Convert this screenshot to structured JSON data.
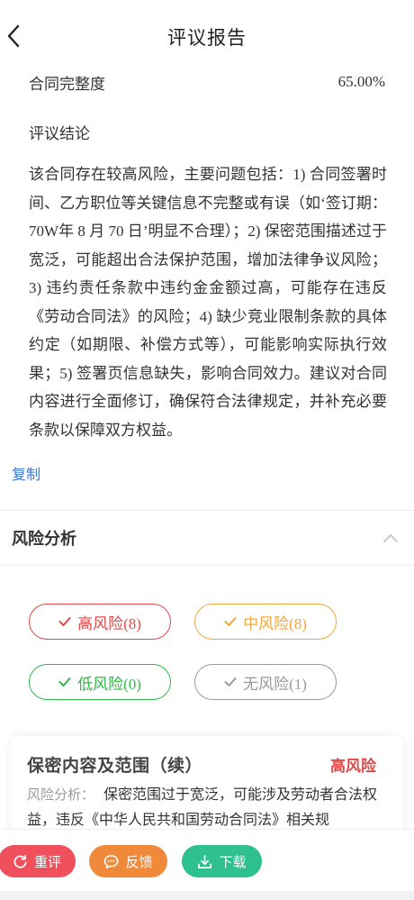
{
  "header": {
    "title": "评议报告",
    "back_icon": "chevron-left-icon"
  },
  "completeness": {
    "label": "合同完整度",
    "value": "65.00%"
  },
  "conclusion": {
    "label": "评议结论",
    "text": "该合同存在较高风险，主要问题包括：1) 合同签署时间、乙方职位等关键信息不完整或有误（如‘签订期：70W年 8 月 70 日’明显不合理）；2) 保密范围描述过于宽泛，可能超出合法保护范围，增加法律争议风险；3) 违约责任条款中违约金金额过高，可能存在违反《劳动合同法》的风险；4) 缺少竞业限制条款的具体约定（如期限、补偿方式等），可能影响实际执行效果；5) 签署页信息缺失，影响合同效力。建议对合同内容进行全面修订，确保符合法律规定，并补充必要条款以保障双方权益。"
  },
  "copy_label": "复制",
  "risk_section": {
    "label": "风险分析",
    "collapse_icon": "chevron-up-icon"
  },
  "risk_filters": [
    {
      "label": "高风险(8)",
      "color": "#e04848"
    },
    {
      "label": "中风险(8)",
      "color": "#f0a83c"
    },
    {
      "label": "低风险(0)",
      "color": "#2fb845"
    },
    {
      "label": "无风险(1)",
      "color": "#999999"
    }
  ],
  "risk_card": {
    "title": "保密内容及范围（续）",
    "level": "高风险",
    "analysis_label": "风险分析：",
    "analysis_text": "保密范围过于宽泛，可能涉及劳动者合法权益，违反《中华人民共和国劳动合同法》相关规"
  },
  "actions": {
    "rereview": "重评",
    "feedback": "反馈",
    "download": "下载"
  }
}
